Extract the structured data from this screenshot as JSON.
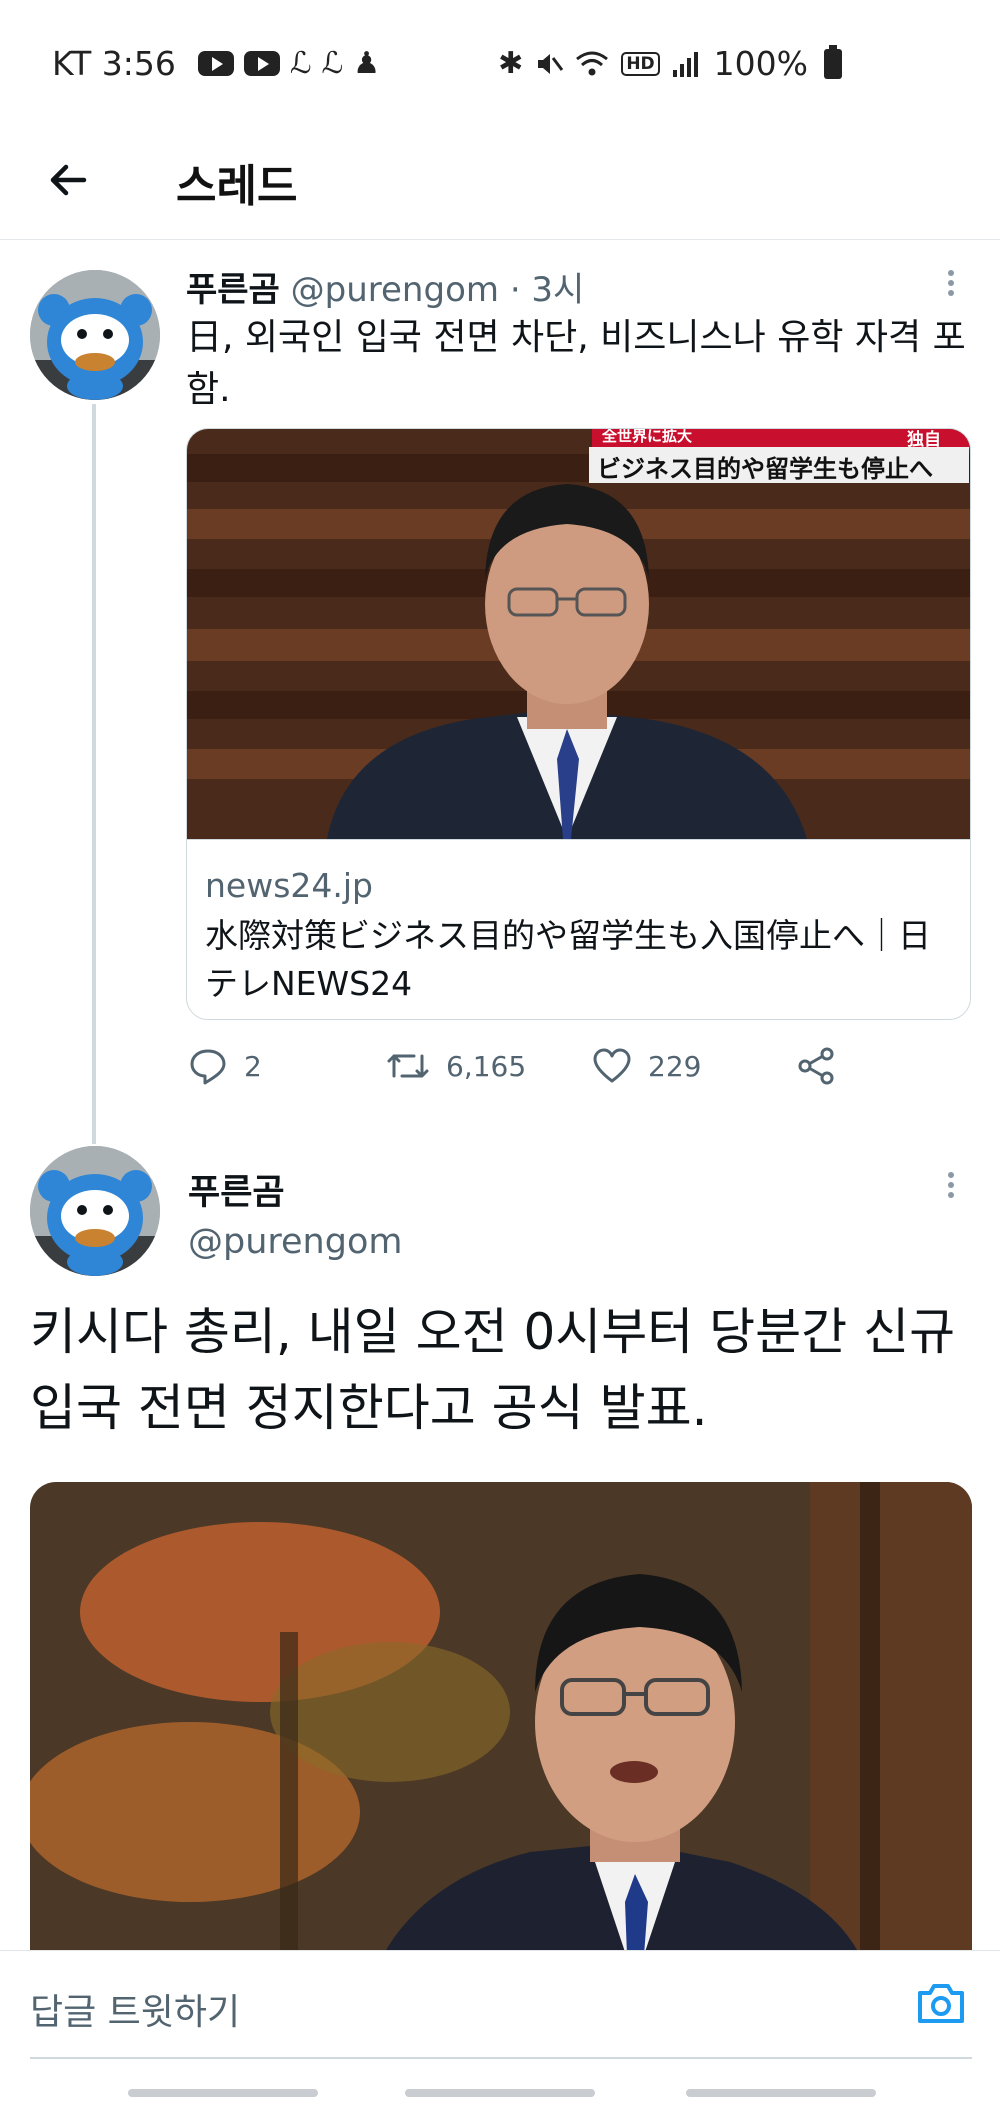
{
  "status_bar": {
    "carrier_time": "KT 3:56",
    "hd": "HD",
    "battery": "100%"
  },
  "header": {
    "title": "스레드"
  },
  "tweet1": {
    "name": "푸른곰",
    "handle": "@purengom",
    "time": "· 3시",
    "text": "日, 외국인 입국 전면 차단, 비즈니스나 유학 자격 포함.",
    "card": {
      "image_caption_top": "全世界に拡大",
      "image_caption_tag": "独自",
      "image_caption": "ビジネス目的や留学生も停止へ",
      "domain": "news24.jp",
      "title": "水際対策ビジネス目的や留学生も入国停止へ｜日テレNEWS24"
    },
    "actions": {
      "replies": "2",
      "retweets": "6,165",
      "likes": "229"
    }
  },
  "tweet2": {
    "name": "푸른곰",
    "handle": "@purengom",
    "text": "키시다 총리, 내일 오전 0시부터 당분간 신규 입국 전면 정지한다고 공식 발표."
  },
  "reply_bar": {
    "placeholder": "답글 트윗하기"
  },
  "colors": {
    "secondary_text": "#536471",
    "accent": "#1d9bf0",
    "border": "#cfd9de"
  }
}
